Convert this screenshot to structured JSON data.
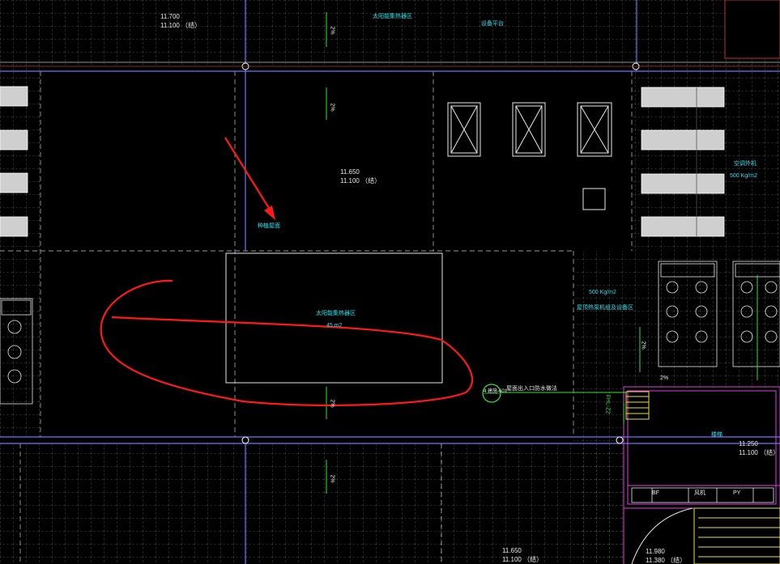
{
  "colors": {
    "background": "#000000",
    "grid": "#8a8a8a",
    "axis_blue": "#6f73ff",
    "magenta": "#e040e0",
    "cyan": "#22e6f0",
    "green": "#36e13a",
    "annotation_red": "#ff1a1a",
    "equipment": "#d8d8d8"
  },
  "labels": {
    "elev_top_1": "11.700",
    "elev_top_2": "11.100 （结）",
    "slope_top": "2%",
    "solar_top": "太阳能集热器区",
    "cyan_top_right": "设备平台",
    "slope_mid": "2%",
    "elev_mid_1": "11.650",
    "elev_mid_2": "11.100 （结）",
    "arrow_target": "种植屋面",
    "ac_label": "空调外机",
    "ac_load": "500 Kg/m2",
    "load_right": "500 Kg/m2",
    "equipment_zone": "屋顶热泵机组及设备区",
    "solar_center": "太阳能集热器区",
    "solar_area": "45 m2",
    "slope_center": "2%",
    "callout_circle": "4 建施-601",
    "callout_text": "屋面出入口防水做法",
    "slope_right_1": "2%",
    "slope_right_2": "2%",
    "small_tag": "FHL-Z2",
    "room_name": "楼梯",
    "elev_room_1": "11.250",
    "elev_room_2": "11.100 （结）",
    "slope_bottom": "2%",
    "elev_bottom_1": "11.650",
    "elev_bottom_2": "11.100 （结）",
    "elev_corner_1": "11.980",
    "elev_corner_2": "11.380 （结）",
    "tags": [
      "BF",
      "风机",
      "PY"
    ]
  }
}
